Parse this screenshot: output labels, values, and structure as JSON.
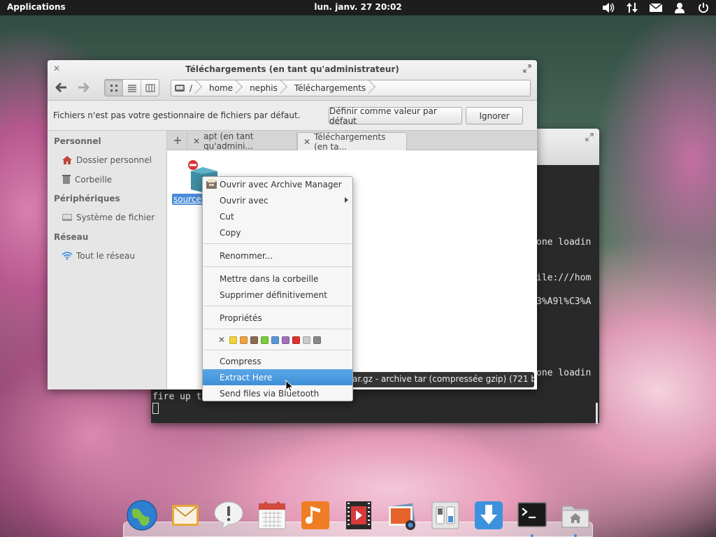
{
  "panel": {
    "applications": "Applications",
    "clock": "lun. janv. 27 20:02",
    "tray_icons": [
      "volume-icon",
      "network-icon",
      "mail-icon",
      "user-icon",
      "power-icon"
    ]
  },
  "terminal": {
    "lines": [
      "one loadin",
      "ile:///hom",
      "3%A9l%C3%A",
      "one loadin",
      "fire up t"
    ]
  },
  "file_manager": {
    "title": "Téléchargements (en tant qu'administrateur)",
    "path": [
      "/",
      "home",
      "nephis",
      "Téléchargements"
    ],
    "infobar": {
      "message": "Fichiers n'est pas votre gestionnaire de fichiers par défaut.",
      "default_btn": "Définir comme valeur par défaut",
      "ignore_btn": "Ignorer"
    },
    "sidebar": {
      "personal": "Personnel",
      "home": "Dossier personnel",
      "trash": "Corbeille",
      "devices": "Périphériques",
      "filesystem": "Système de fichier",
      "network": "Réseau",
      "all_network": "Tout le réseau"
    },
    "tabs": [
      "apt (en tant qu'admini...",
      "Téléchargements (en ta..."
    ],
    "file_label": "sources"
  },
  "tooltip": "ar.gz - archive tar (compressée gzip) (721 bytes)",
  "context_menu": {
    "open_with_archive": "Ouvrir avec Archive Manager",
    "open_with": "Ouvrir avec",
    "cut": "Cut",
    "copy": "Copy",
    "rename": "Renommer...",
    "trash": "Mettre dans la corbeille",
    "delete": "Supprimer définitivement",
    "properties": "Propriétés",
    "compress": "Compress",
    "extract": "Extract Here",
    "bluetooth": "Send files via Bluetooth",
    "colors": [
      "#f2d43a",
      "#f0a03c",
      "#8a6a50",
      "#7dcc3a",
      "#5b96d6",
      "#a070b8",
      "#e03030",
      "#cccccc",
      "#888888"
    ]
  },
  "dock": [
    "browser-icon",
    "mail-icon",
    "notification-icon",
    "calendar-icon",
    "music-icon",
    "video-icon",
    "photos-icon",
    "settings-icon",
    "downloads-icon",
    "terminal-icon",
    "home-folder-icon"
  ]
}
